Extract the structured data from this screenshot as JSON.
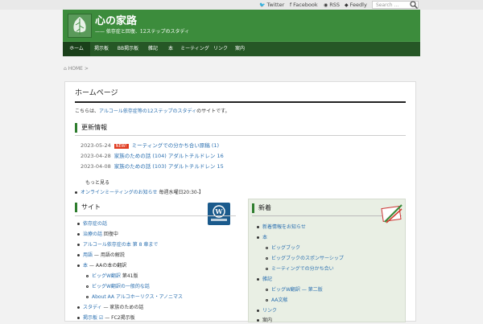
{
  "topbar": {
    "links": [
      {
        "icon": "twitter-icon",
        "glyph": "🐦",
        "label": "Twitter"
      },
      {
        "icon": "facebook-icon",
        "glyph": "f",
        "label": "Facebook"
      },
      {
        "icon": "rss-icon",
        "glyph": "◉",
        "label": "RSS"
      },
      {
        "icon": "feedly-icon",
        "glyph": "◆",
        "label": "Feedly"
      }
    ],
    "search_placeholder": "Search ..."
  },
  "header": {
    "title": "心の家路",
    "subtitle": "—— 依存症と回復、12ステップのスタディ"
  },
  "nav": {
    "items": [
      "ホーム",
      "掲示板",
      "BB掲示板",
      "雑記",
      "本",
      "ミーティング",
      "リンク",
      "案内"
    ]
  },
  "breadcrumb": {
    "home": "HOME",
    "sep": ">"
  },
  "main": {
    "page_title": "ホームページ",
    "intro_prefix": "こちらは、",
    "intro_link": "アルコール依存症等の12ステップのスタディ",
    "intro_suffix": "のサイトです。",
    "updates_heading": "更新情報",
    "posts": [
      {
        "date": "2023-05-24",
        "new": "NEW!",
        "link": "ミーティングでの分かち合い原稿",
        "suffix": " (1)"
      },
      {
        "date": "2023-04-28",
        "new": "",
        "link": "家族のための話 (104)",
        "suffix": " アダルトチルドレン 16"
      },
      {
        "date": "2023-04-08",
        "new": "",
        "link": "家族のための話 (103)",
        "suffix": " アダルトチルドレン 15"
      }
    ],
    "more_label": "もっと見る",
    "event_link": "オンラインミーティングのお知らせ",
    "event_suffix": " 毎週水曜日20:30-】",
    "left_heading": "サイト",
    "left_items": [
      {
        "level": 1,
        "link": "依存症の話",
        "suffix": ""
      },
      {
        "level": 1,
        "link": "治療の話",
        "suffix": " 回復中"
      },
      {
        "level": 1,
        "link": "アルコール依存症の本",
        "suffix": " 第 8 章まで"
      },
      {
        "level": 1,
        "link": "用語",
        "suffix": " — 用語の解説"
      },
      {
        "level": 1,
        "link": "本",
        "suffix": " — AAの本の翻訳"
      },
      {
        "level": 2,
        "link": "ビッグW翻訳",
        "suffix": " 第41版"
      },
      {
        "level": 2,
        "link": "ビッグW翻訳の一般的な話",
        "suffix": ""
      },
      {
        "level": 2,
        "link": "About AA",
        "suffix": " アルコホーリクス・アノニマス"
      },
      {
        "level": 1,
        "link": "スタディ",
        "suffix": " — 家族のための話"
      },
      {
        "level": 1,
        "link": "掲示板",
        "suffix": " — FC2掲示板"
      }
    ],
    "right_heading": "新着",
    "right_items": [
      {
        "level": 1,
        "link": "新着情報をお知らせ"
      },
      {
        "level": 1,
        "link": "本"
      },
      {
        "level": 2,
        "link": "ビッグブック"
      },
      {
        "level": 2,
        "link": "ビッグブックのスポンサーシップ"
      },
      {
        "level": 2,
        "link": "ミーティングでの分かち合い"
      },
      {
        "level": 1,
        "link": "雑記"
      },
      {
        "level": 2,
        "link": "ビッグW翻訳 — 第二版"
      },
      {
        "level": 2,
        "link": "AA文献"
      },
      {
        "level": 1,
        "link": "リンク"
      },
      {
        "level": 1,
        "link": "案内"
      }
    ]
  },
  "colors": {
    "header_bg": "#3c8c3c",
    "nav_bg": "#265726",
    "link": "#2a6fb0",
    "accent": "#2e7d2e",
    "new_badge": "#e03a1e"
  }
}
